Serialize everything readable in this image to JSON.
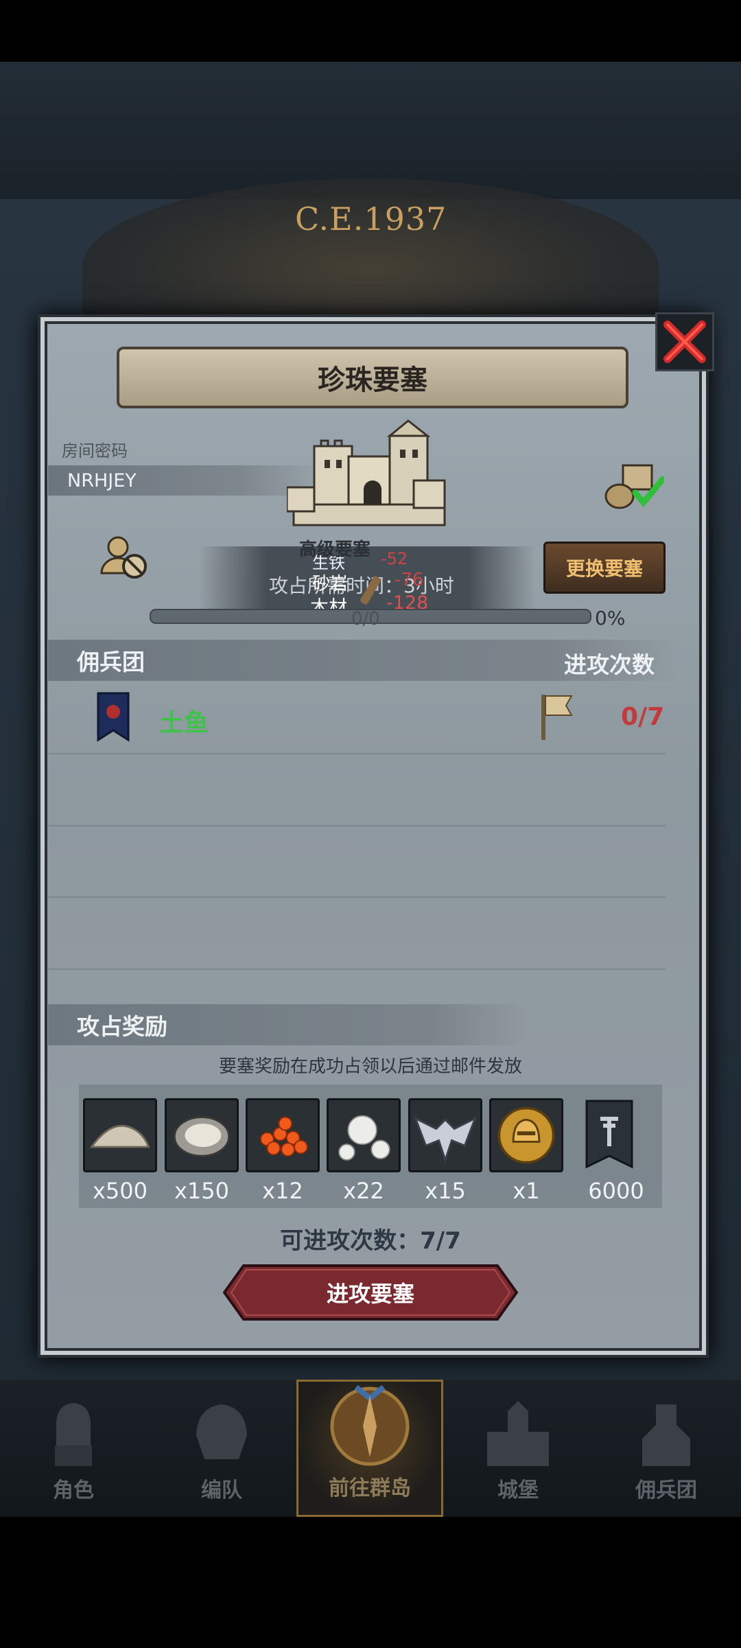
{
  "header": {
    "era": "C.E.1937"
  },
  "dialog": {
    "title": "珍珠要塞",
    "room_code_label": "房间密码",
    "room_code": "NRHJEY",
    "fortress_type": "高级要塞",
    "swap_button": "更换要塞",
    "overlay_texts": {
      "iron_label": "生铁",
      "iron_value": "-52",
      "sandstone_label": "砂岩",
      "sandstone_value": "-76",
      "wood_label": "木材",
      "wood_value": "-128",
      "occupy_time_text": "攻占所需时间：3小时",
      "progress_count": "0/0"
    },
    "progress_percent": "0%",
    "progress_value": 0
  },
  "mercenary_section": {
    "title": "佣兵团",
    "attacks_header": "进攻次数",
    "rows": [
      {
        "name": "土鱼",
        "attacks": "0/7"
      }
    ]
  },
  "rewards_section": {
    "title": "攻占奖励",
    "note": "要塞奖励在成功占领以后通过邮件发放",
    "items": [
      {
        "icon": "sand-pile-icon",
        "count": "x500"
      },
      {
        "icon": "oyster-icon",
        "count": "x150"
      },
      {
        "icon": "fish-roe-icon",
        "count": "x12"
      },
      {
        "icon": "pearl-icon",
        "count": "x22"
      },
      {
        "icon": "winged-emblem-icon",
        "count": "x15"
      },
      {
        "icon": "golden-helmet-medal-icon",
        "count": "x1"
      },
      {
        "icon": "banner-points-icon",
        "count": "6000"
      }
    ],
    "attempts_text": "可进攻次数：7/7",
    "attack_button": "进攻要塞"
  },
  "nav": {
    "items": [
      {
        "label": "角色",
        "icon": "knight-icon"
      },
      {
        "label": "编队",
        "icon": "helmet-squad-icon"
      },
      {
        "label": "前往群岛",
        "icon": "compass-icon"
      },
      {
        "label": "城堡",
        "icon": "castle-icon"
      },
      {
        "label": "佣兵团",
        "icon": "mercenary-icon"
      }
    ]
  },
  "colors": {
    "accent_gold": "#f0c070",
    "danger_red": "#c33a3a",
    "name_green": "#3ec24a",
    "attack_button": "#7a2a2e"
  }
}
